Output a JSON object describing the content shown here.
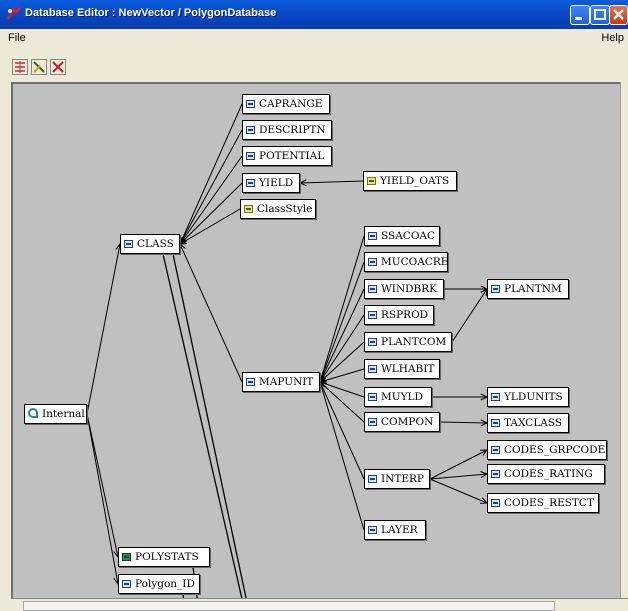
{
  "window": {
    "title": "Database Editor : NewVector / PolygonDatabase",
    "app_icon": "database-editor-icon",
    "controls": [
      "minimize-icon",
      "maximize-icon",
      "close-icon"
    ]
  },
  "menu": {
    "file": "File",
    "help": "Help"
  },
  "toolbar": {
    "tools": [
      "layout-tree-icon",
      "edit-relation-icon",
      "delete-relation-icon"
    ]
  },
  "graph": {
    "nodes": [
      {
        "id": "internal",
        "label": "Internal",
        "icon": "internal-table-icon"
      },
      {
        "id": "class",
        "label": "CLASS",
        "icon": "table-icon"
      },
      {
        "id": "polystats",
        "label": "POLYSTATS",
        "icon": "stats-table-icon"
      },
      {
        "id": "polygon_id",
        "label": "Polygon_ID",
        "icon": "table-icon"
      },
      {
        "id": "caprange",
        "label": "CAPRANGE",
        "icon": "table-icon"
      },
      {
        "id": "descriptn",
        "label": "DESCRIPTN",
        "icon": "table-icon"
      },
      {
        "id": "potential",
        "label": "POTENTIAL",
        "icon": "table-icon"
      },
      {
        "id": "yield",
        "label": "YIELD",
        "icon": "table-icon"
      },
      {
        "id": "classstyle",
        "label": "ClassStyle",
        "icon": "style-table-icon"
      },
      {
        "id": "yield_oats",
        "label": "YIELD_OATS",
        "icon": "style-table-icon"
      },
      {
        "id": "mapunit",
        "label": "MAPUNIT",
        "icon": "table-icon"
      },
      {
        "id": "ssacoac",
        "label": "SSACOAC",
        "icon": "table-icon"
      },
      {
        "id": "mucoacre",
        "label": "MUCOACRE",
        "icon": "table-icon"
      },
      {
        "id": "windbrk",
        "label": "WINDBRK",
        "icon": "table-icon"
      },
      {
        "id": "rsprod",
        "label": "RSPROD",
        "icon": "table-icon"
      },
      {
        "id": "plantcom",
        "label": "PLANTCOM",
        "icon": "table-icon"
      },
      {
        "id": "wlhabit",
        "label": "WLHABIT",
        "icon": "table-icon"
      },
      {
        "id": "muyld",
        "label": "MUYLD",
        "icon": "table-icon"
      },
      {
        "id": "compon",
        "label": "COMPON",
        "icon": "table-icon"
      },
      {
        "id": "interp",
        "label": "INTERP",
        "icon": "table-icon"
      },
      {
        "id": "layer",
        "label": "LAYER",
        "icon": "table-icon"
      },
      {
        "id": "plantnm",
        "label": "PLANTNM",
        "icon": "table-icon"
      },
      {
        "id": "yldunits",
        "label": "YLDUNITS",
        "icon": "table-icon"
      },
      {
        "id": "taxclass",
        "label": "TAXCLASS",
        "icon": "table-icon"
      },
      {
        "id": "codes_grpcode",
        "label": "CODES_GRPCODE",
        "icon": "table-icon"
      },
      {
        "id": "codes_rating",
        "label": "CODES_RATING",
        "icon": "table-icon"
      },
      {
        "id": "codes_restct",
        "label": "CODES_RESTCT",
        "icon": "table-icon"
      }
    ],
    "edges": [
      [
        "internal",
        "class"
      ],
      [
        "internal",
        "polystats"
      ],
      [
        "internal",
        "polygon_id"
      ],
      [
        "caprange",
        "class"
      ],
      [
        "descriptn",
        "class"
      ],
      [
        "potential",
        "class"
      ],
      [
        "yield",
        "class"
      ],
      [
        "classstyle",
        "class"
      ],
      [
        "yield_oats",
        "yield"
      ],
      [
        "mapunit",
        "class"
      ],
      [
        "ssacoac",
        "mapunit"
      ],
      [
        "mucoacre",
        "mapunit"
      ],
      [
        "windbrk",
        "mapunit"
      ],
      [
        "rsprod",
        "mapunit"
      ],
      [
        "plantcom",
        "mapunit"
      ],
      [
        "wlhabit",
        "mapunit"
      ],
      [
        "muyld",
        "mapunit"
      ],
      [
        "compon",
        "mapunit"
      ],
      [
        "interp",
        "mapunit"
      ],
      [
        "layer",
        "mapunit"
      ],
      [
        "windbrk",
        "plantnm"
      ],
      [
        "plantcom",
        "plantnm"
      ],
      [
        "muyld",
        "yldunits"
      ],
      [
        "compon",
        "taxclass"
      ],
      [
        "interp",
        "codes_grpcode"
      ],
      [
        "interp",
        "codes_rating"
      ],
      [
        "interp",
        "codes_restct"
      ]
    ]
  }
}
